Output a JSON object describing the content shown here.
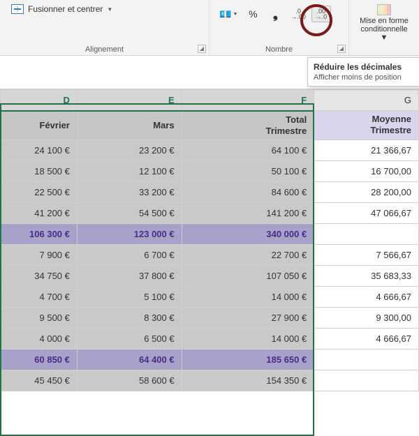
{
  "ribbon": {
    "alignment": {
      "merge_label": "Fusionner et centrer",
      "group_label": "Alignement"
    },
    "number": {
      "group_label": "Nombre",
      "accounting": "€",
      "percent": "%",
      "thousands": ",",
      "inc_dec": ".0\n.00",
      "dec_dec": ".00\n.0"
    },
    "conditional": {
      "line1": "Mise en forme",
      "line2": "conditionnelle"
    }
  },
  "tooltip": {
    "title": "Réduire les décimales",
    "body": "Afficher moins de position"
  },
  "columns": {
    "D": "D",
    "E": "E",
    "F": "F",
    "G": "G"
  },
  "headers": {
    "D": "Février",
    "E": "Mars",
    "F_l1": "Total",
    "F_l2": "Trimestre",
    "G_l1": "Moyenne",
    "G_l2": "Trimestre"
  },
  "rows": [
    {
      "kind": "data",
      "D": "24 100 €",
      "E": "23 200 €",
      "F": "64 100 €",
      "G": "21 366,67"
    },
    {
      "kind": "data",
      "D": "18 500 €",
      "E": "12 100 €",
      "F": "50 100 €",
      "G": "16 700,00"
    },
    {
      "kind": "data",
      "D": "22 500 €",
      "E": "33 200 €",
      "F": "84 600 €",
      "G": "28 200,00"
    },
    {
      "kind": "data",
      "D": "41 200 €",
      "E": "54 500 €",
      "F": "141 200 €",
      "G": "47 066,67"
    },
    {
      "kind": "total",
      "D": "106 300 €",
      "E": "123 000 €",
      "F": "340 000 €",
      "G": ""
    },
    {
      "kind": "data",
      "D": "7 900 €",
      "E": "6 700 €",
      "F": "22 700 €",
      "G": "7 566,67"
    },
    {
      "kind": "data",
      "D": "34 750 €",
      "E": "37 800 €",
      "F": "107 050 €",
      "G": "35 683,33"
    },
    {
      "kind": "data",
      "D": "4 700 €",
      "E": "5 100 €",
      "F": "14 000 €",
      "G": "4 666,67"
    },
    {
      "kind": "data",
      "D": "9 500 €",
      "E": "8 300 €",
      "F": "27 900 €",
      "G": "9 300,00"
    },
    {
      "kind": "data",
      "D": "4 000 €",
      "E": "6 500 €",
      "F": "14 000 €",
      "G": "4 666,67"
    },
    {
      "kind": "total",
      "D": "60 850 €",
      "E": "64 400 €",
      "F": "185 650 €",
      "G": ""
    },
    {
      "kind": "data",
      "D": "45 450 €",
      "E": "58 600 €",
      "F": "154 350 €",
      "G": ""
    }
  ]
}
